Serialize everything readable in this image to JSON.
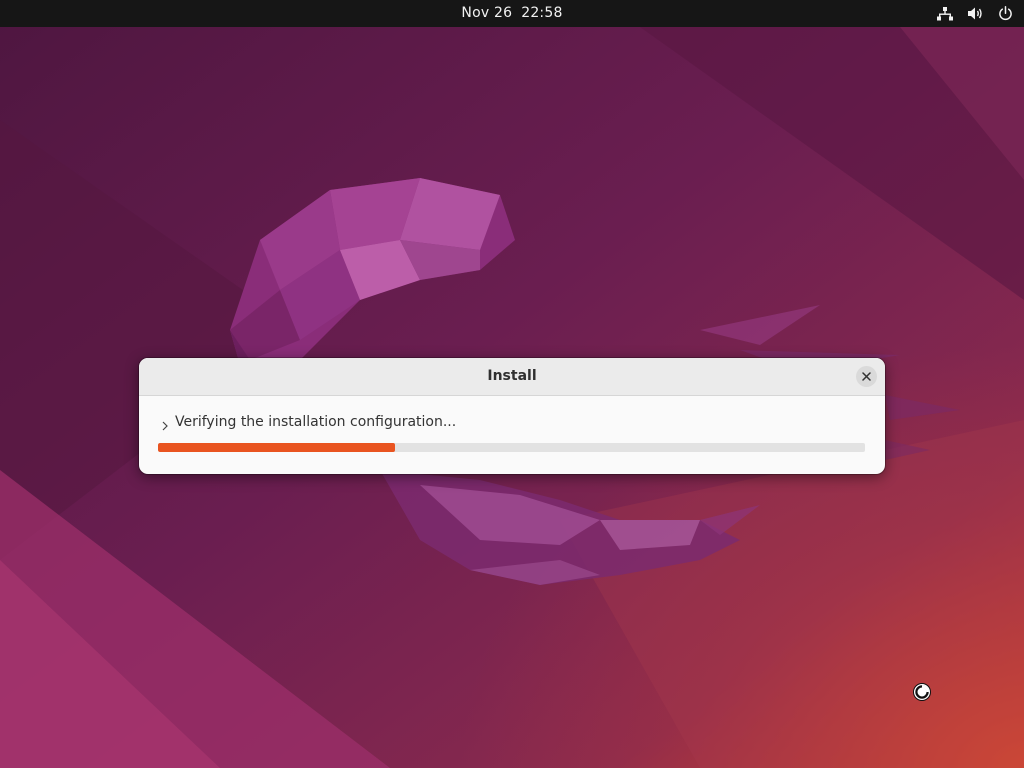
{
  "topbar": {
    "date": "Nov 26",
    "time": "22:58",
    "icons": [
      "network-icon",
      "volume-icon",
      "power-icon"
    ]
  },
  "dialog": {
    "title": "Install",
    "status": "Verifying the installation configuration...",
    "progress": 0.335
  },
  "colors": {
    "accent": "#e95420",
    "topbar": "#161616",
    "wallpaper_base": "#5c1c48"
  },
  "cursor": {
    "icon": "busy-cursor-icon"
  }
}
